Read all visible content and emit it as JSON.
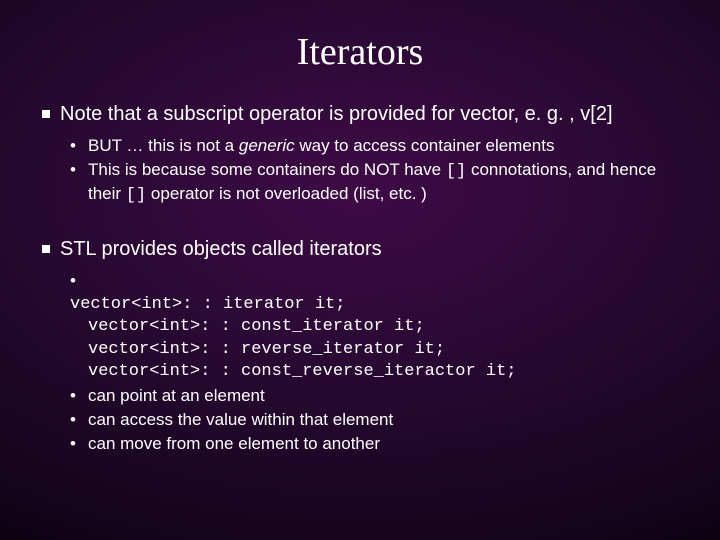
{
  "title": "Iterators",
  "section1": {
    "heading_pre": "Note that a subscript operator is provided for vector, e. g. , v[2]",
    "sub1_pre": "BUT … this is not a ",
    "sub1_em": "generic",
    "sub1_post": " way to access container elements",
    "sub2_pre": "This is because some containers do NOT have ",
    "sub2_code": "[]",
    "sub2_mid": " connotations, and hence their ",
    "sub2_code2": "[]",
    "sub2_post": " operator is not overloaded (list, etc. )"
  },
  "section2": {
    "heading": "STL provides objects called iterators",
    "code": {
      "l1": "vector<int>: : iterator it;",
      "l2": "vector<int>: : const_iterator it;",
      "l3": "vector<int>: : reverse_iterator it;",
      "l4": "vector<int>: : const_reverse_iteractor it;"
    },
    "sub2": "can point at an element",
    "sub3": "can access the value within that element",
    "sub4": "can move from one element to another"
  }
}
